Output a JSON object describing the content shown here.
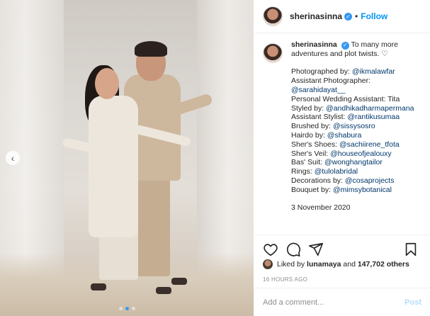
{
  "post": {
    "username": "sherinasinna",
    "follow_label": "Follow",
    "separator": "•",
    "verified_glyph": "✓"
  },
  "caption": {
    "username": "sherinasinna",
    "text_line1": "To many more",
    "text_line2": "adventures and plot twists. ♡",
    "credits": [
      {
        "label": "Photographed by: ",
        "mention": "@ikmalawfar"
      },
      {
        "label": "Assistant Photographer:",
        "mention": ""
      },
      {
        "label": "",
        "mention": "@sarahidayat__"
      },
      {
        "label": "Personal Wedding Assistant: Tita",
        "mention": ""
      },
      {
        "label": "Styled by: ",
        "mention": "@andhikadharmapermana"
      },
      {
        "label": "Assistant Stylist: ",
        "mention": "@rantikusumaa"
      },
      {
        "label": "Brushed by: ",
        "mention": "@sissysosro"
      },
      {
        "label": "Hairdo by: ",
        "mention": "@shabura"
      },
      {
        "label": "Sher's Shoes: ",
        "mention": "@sachiirene_tfota"
      },
      {
        "label": "Sher's Veil: ",
        "mention": "@houseofjealouxy"
      },
      {
        "label": "Bas' Suit: ",
        "mention": "@wonghangtailor"
      },
      {
        "label": "Rings: ",
        "mention": "@tulolabridal"
      },
      {
        "label": "Decorations by: ",
        "mention": "@cosaprojects"
      },
      {
        "label": "Bouquet by: ",
        "mention": "@mimsybotanical"
      }
    ],
    "date": "3 November 2020"
  },
  "likes": {
    "prefix": "Liked by ",
    "user": "lunamaya",
    "middle": " and ",
    "others": "147,702 others"
  },
  "timestamp": "16 HOURS AGO",
  "comment": {
    "placeholder": "Add a comment...",
    "post_label": "Post"
  },
  "carousel": {
    "prev_glyph": "‹",
    "dot_count": 3,
    "active_index": 1
  },
  "icons": [
    "heart-icon",
    "comment-icon",
    "share-icon",
    "bookmark-icon",
    "verified-icon",
    "chevron-left-icon"
  ],
  "colors": {
    "accent": "#0095f6",
    "mention": "#00376b",
    "active_dot": "#3897f0",
    "post_disabled": "#b2dffc"
  }
}
